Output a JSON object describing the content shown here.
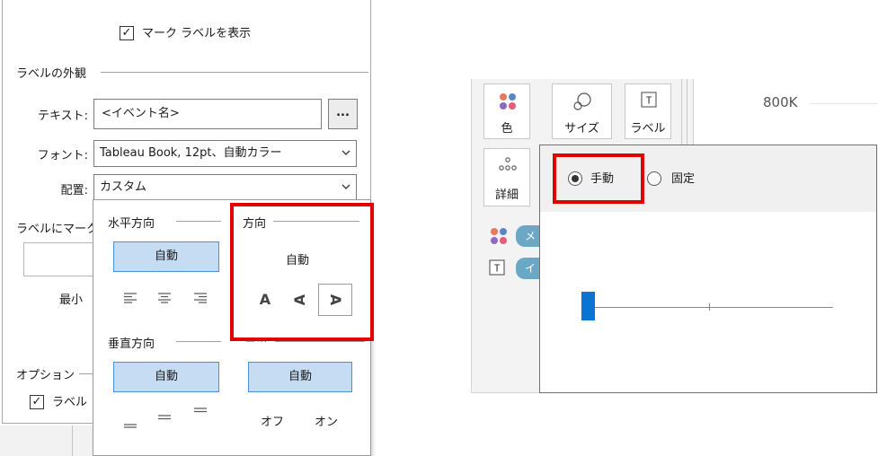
{
  "left_panel": {
    "show_mark_labels": {
      "label": "マーク ラベルを表示",
      "checked": true
    },
    "appearance_section": "ラベルの外観",
    "text_row": {
      "label": "テキスト:",
      "value": "<イベント名>",
      "button": "..."
    },
    "font_row": {
      "label": "フォント:",
      "value": "Tableau Book, 12pt、自動カラー"
    },
    "alignment_row": {
      "label": "配置:",
      "value": "カスタム"
    },
    "label_marks_partial": "ラベルにマーク",
    "min_partial": "最小",
    "options_section": "オプション",
    "options_checkbox_partial": {
      "label": "ラベル",
      "checked": true
    },
    "alignment_popup": {
      "horizontal": {
        "title": "水平方向",
        "auto": "自動"
      },
      "vertical": {
        "title": "垂直方向",
        "auto": "自動"
      },
      "direction": {
        "title": "方向",
        "auto": "自動",
        "options": [
          "A",
          "A",
          "A"
        ],
        "selected_index": 2
      },
      "wrap": {
        "title_partial": "ラップ",
        "auto": "自動",
        "off": "オフ",
        "on": "オン"
      }
    }
  },
  "right_panel": {
    "axis_label": "800K",
    "marks_cards": [
      {
        "label": "色",
        "icon": "color-dots-icon"
      },
      {
        "label": "サイズ",
        "icon": "size-circles-icon"
      },
      {
        "label": "ラベル",
        "icon": "label-t-icon"
      },
      {
        "label": "詳細",
        "icon": "detail-dots-icon"
      }
    ],
    "field_pills": [
      {
        "label": "メ",
        "icon": "color-dots-icon"
      },
      {
        "label": "イ",
        "icon": "label-t-icon"
      }
    ],
    "size_popup": {
      "manual": {
        "label": "手動",
        "selected": true
      },
      "fixed": {
        "label": "固定",
        "selected": false
      },
      "slider_level": 0.0
    }
  },
  "colors": {
    "highlight_red": "#e00000",
    "selected_blue_fill": "#c6dcf2",
    "selected_blue_border": "#4d8ed4",
    "slider_thumb": "#0a74d4",
    "pill_teal": "#6aa8c6"
  }
}
